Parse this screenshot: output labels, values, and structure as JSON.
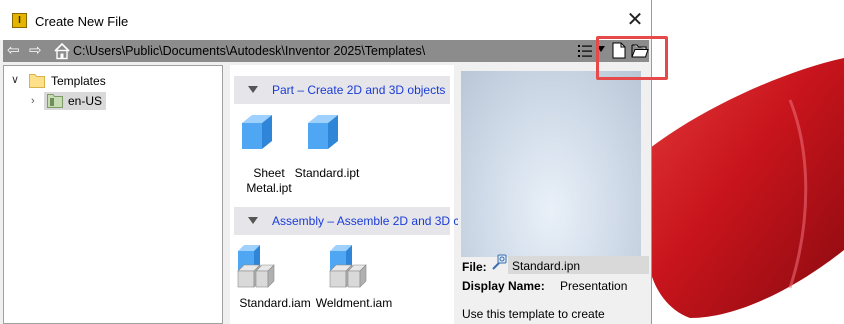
{
  "window": {
    "title": "Create New File",
    "close_glyph": "✕"
  },
  "navbar": {
    "back_glyph": "⇦",
    "forward_glyph": "⇨",
    "path": "C:\\Users\\Public\\Documents\\Autodesk\\Inventor 2025\\Templates\\"
  },
  "tree": {
    "items": [
      {
        "label": "Templates",
        "expanded": true
      },
      {
        "label": "en-US",
        "expanded": false,
        "selected": true
      }
    ]
  },
  "templates": {
    "categories": [
      {
        "label": "Part – Create 2D and 3D objects",
        "items": [
          {
            "label": "Sheet Metal.ipt",
            "icon": "part-cube-icon"
          },
          {
            "label": "Standard.ipt",
            "icon": "part-cube-icon"
          }
        ]
      },
      {
        "label": "Assembly – Assemble 2D and 3D c",
        "items": [
          {
            "label": "Standard.iam",
            "icon": "assembly-icon"
          },
          {
            "label": "Weldment.iam",
            "icon": "assembly-icon"
          }
        ]
      }
    ]
  },
  "preview": {
    "file_label": "File:",
    "file_name": "Standard.ipn",
    "display_name_label": "Display Name:",
    "display_name_value": "Presentation",
    "description": "Use this template to create"
  },
  "colors": {
    "highlight": "#e64949",
    "category_text": "#1a3cd6",
    "background_shape": "#c8141c"
  }
}
